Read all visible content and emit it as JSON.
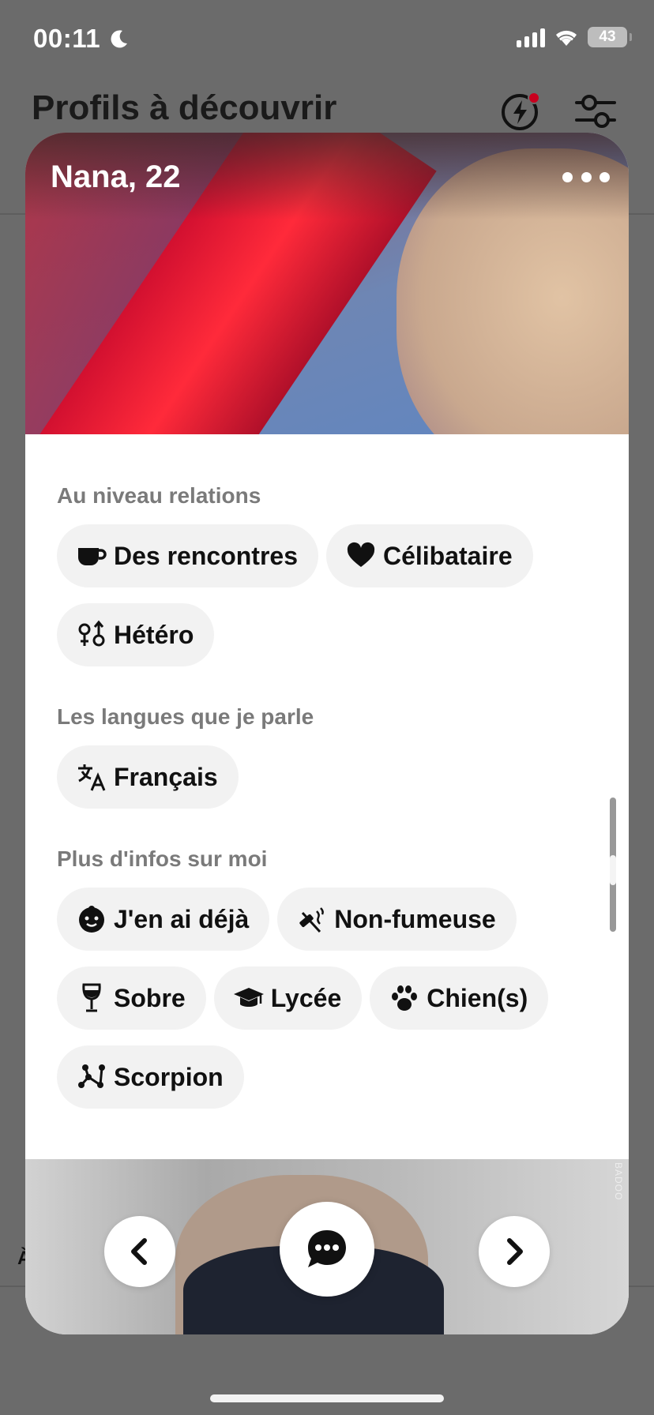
{
  "status_bar": {
    "time": "00:11",
    "battery": "43"
  },
  "header": {
    "title": "Profils à découvrir",
    "left_peek": "À"
  },
  "profile": {
    "name_age": "Nana, 22",
    "watermark": "BADOO"
  },
  "sections": {
    "relations": {
      "title": "Au niveau relations",
      "chips": [
        {
          "label": "Des rencontres",
          "icon": "coffee-cup-icon"
        },
        {
          "label": "Célibataire",
          "icon": "heart-icon"
        },
        {
          "label": "Hétéro",
          "icon": "hetero-symbol-icon"
        }
      ]
    },
    "languages": {
      "title": "Les langues que je parle",
      "chips": [
        {
          "label": "Français",
          "icon": "translate-icon"
        }
      ]
    },
    "more_info": {
      "title": "Plus d'infos sur moi",
      "chips": [
        {
          "label": "J'en ai déjà",
          "icon": "baby-icon"
        },
        {
          "label": "Non-fumeuse",
          "icon": "no-smoking-icon"
        },
        {
          "label": "Sobre",
          "icon": "wine-glass-icon"
        },
        {
          "label": "Lycée",
          "icon": "graduation-cap-icon"
        },
        {
          "label": "Chien(s)",
          "icon": "paw-icon"
        },
        {
          "label": "Scorpion",
          "icon": "constellation-icon"
        }
      ]
    }
  },
  "colors": {
    "background": "#6b6b6b",
    "card": "#ffffff",
    "chip": "#f2f2f2",
    "notification_dot": "#c8001e",
    "section_title": "#7a7a7a"
  }
}
